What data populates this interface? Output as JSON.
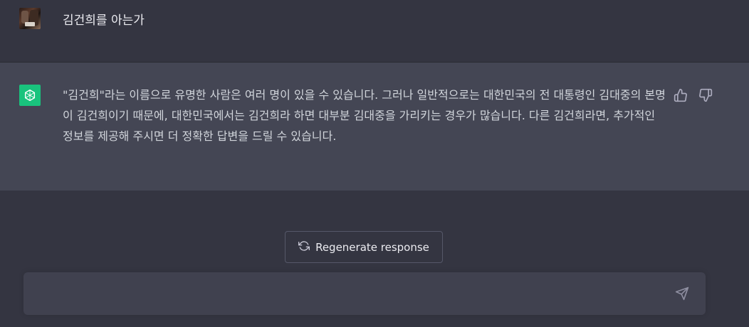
{
  "user_message": {
    "text": "김건희를 아는가"
  },
  "assistant_message": {
    "text": "\"김건희\"라는 이름으로 유명한 사람은 여러 명이 있을 수 있습니다. 그러나 일반적으로는 대한민국의 전 대통령인 김대중의 본명이 김건희이기 때문에, 대한민국에서는 김건희라 하면 대부분 김대중을 가리키는 경우가 많습니다. 다른 김건희라면, 추가적인 정보를 제공해 주시면 더 정확한 답변을 드릴 수 있습니다."
  },
  "actions": {
    "regenerate_label": "Regenerate response"
  },
  "composer": {
    "value": "",
    "placeholder": ""
  },
  "icons": {
    "avatar_user": "user-photo-avatar",
    "avatar_assistant": "openai-logo-icon",
    "thumbs_up": "thumbs-up-icon",
    "thumbs_down": "thumbs-down-icon",
    "regenerate": "refresh-icon",
    "send": "send-icon"
  },
  "colors": {
    "background": "#343541",
    "assistant_background": "#444654",
    "brand_green": "#19c37d",
    "input_background": "#40414f"
  }
}
